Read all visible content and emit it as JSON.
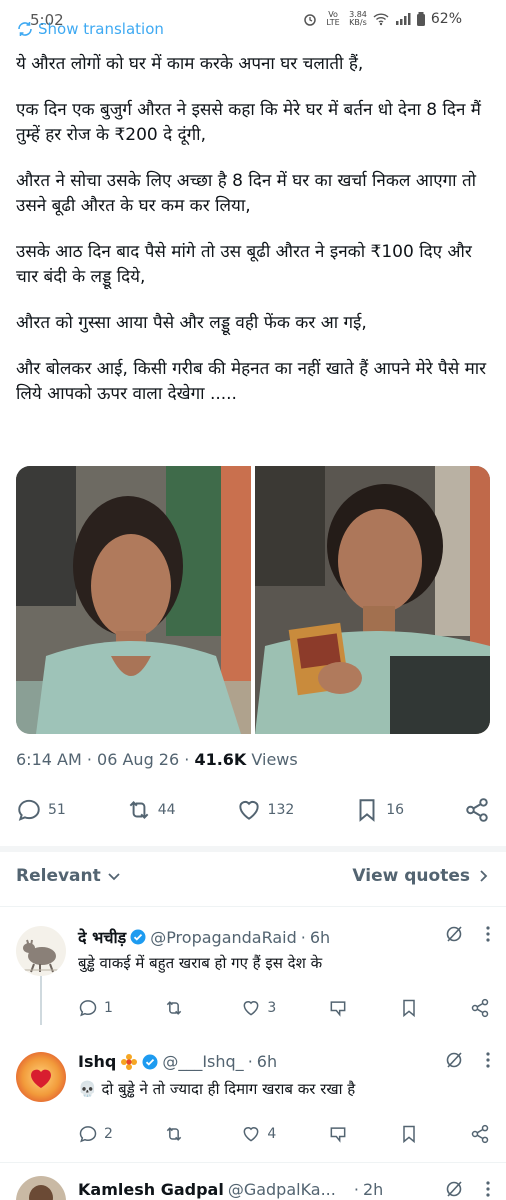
{
  "status_bar": {
    "time": "5:02",
    "carrier": "Vo LTE",
    "net_speed": "3.84",
    "net_unit": "KB/s",
    "battery": "62%"
  },
  "show_translation": "Show translation",
  "post": {
    "paragraphs": [
      "ये औरत लोगों को घर में काम करके अपना घर चलाती हैं,",
      "एक दिन एक बुजुर्ग औरत ने इससे कहा कि मेरे घर में बर्तन धो देना 8 दिन मैं तुम्हें हर रोज के ₹200 दे दूंगी,",
      "औरत ने सोचा उसके लिए अच्छा है 8 दिन में घर का खर्चा निकल आएगा तो उसने बूढी औरत के घर कम कर लिया,",
      "उसके आठ दिन बाद पैसे मांगे तो उस बूढी औरत ने इनको ₹100 दिए और चार बंदी के लड्डू दिये,",
      "औरत को गुस्सा आया पैसे और लड्डू वही फेंक कर आ गई,",
      "और बोलकर आई, किसी गरीब की मेहनत का नहीं खाते हैं आपने मेरे पैसे मार लिये आपको ऊपर वाला देखेगा ....."
    ],
    "time": "6:14 AM",
    "date": "06 Aug 26",
    "views_count": "41.6K",
    "views_label": "Views",
    "stats": {
      "replies": "51",
      "reposts": "44",
      "likes": "132",
      "bookmarks": "16"
    }
  },
  "sort": {
    "left_label": "Relevant",
    "right_label": "View quotes"
  },
  "replies": [
    {
      "name": "दे भचीड़",
      "handle": "@PropagandaRaid",
      "time": "6h",
      "text": "बुड्ढे वाकई में बहुत खराब हो गए हैं इस देश के",
      "replies": "1",
      "reposts": "",
      "likes": "3"
    },
    {
      "name": "Ishq",
      "handle": "@___Ishq_",
      "time": "6h",
      "text": "💀 दो बुड्ढे ने तो ज्यादा ही दिमाग खराब कर रखा है",
      "replies": "2",
      "reposts": "",
      "likes": "4"
    },
    {
      "name": "Kamlesh Gadpal",
      "handle": "@GadpalKa...",
      "time": "2h"
    }
  ],
  "colors": {
    "accent": "#1d9bf0",
    "muted": "#536471",
    "text": "#0f1419"
  }
}
